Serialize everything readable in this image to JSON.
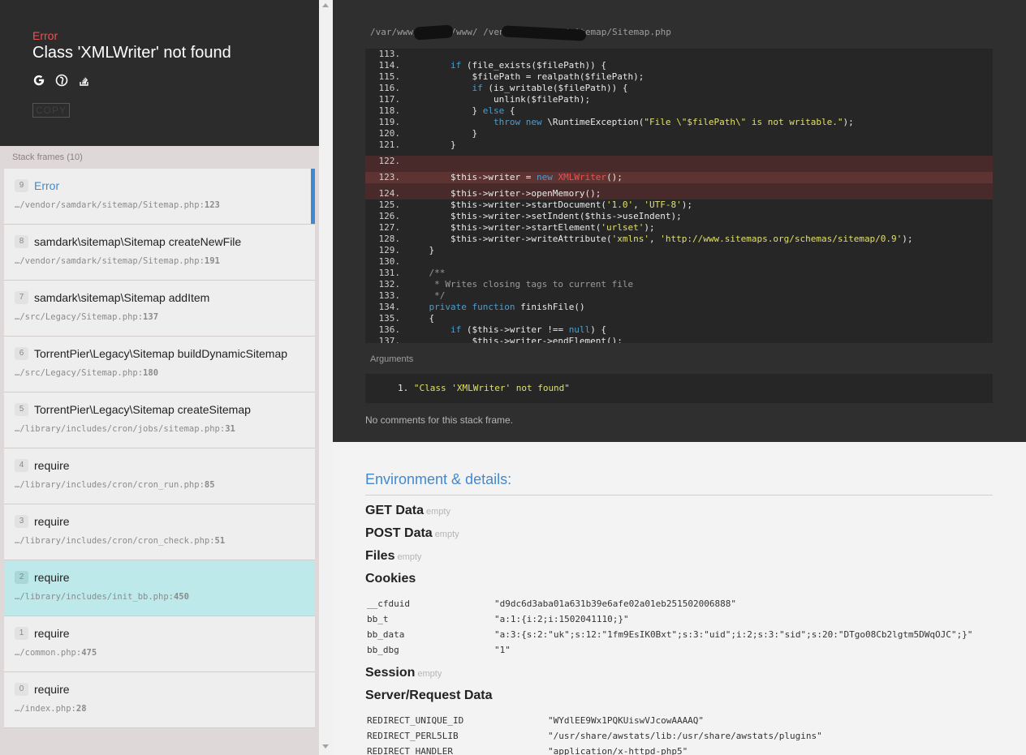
{
  "header": {
    "exception_type": "Error",
    "exception_message": "Class 'XMLWriter' not found",
    "search_icons": [
      "google-icon",
      "duckduckgo-icon",
      "stackoverflow-icon"
    ],
    "copy_label": "COPY"
  },
  "frames_title": "Stack frames (10)",
  "frames": [
    {
      "index": "9",
      "class": "Error",
      "path": "…/vendor/samdark/sitemap/Sitemap.php",
      "line": "123",
      "state": "active"
    },
    {
      "index": "8",
      "class": "samdark\\sitemap\\Sitemap createNewFile",
      "path": "…/vendor/samdark/sitemap/Sitemap.php",
      "line": "191",
      "state": ""
    },
    {
      "index": "7",
      "class": "samdark\\sitemap\\Sitemap addItem",
      "path": "…/src/Legacy/Sitemap.php",
      "line": "137",
      "state": ""
    },
    {
      "index": "6",
      "class": "TorrentPier\\Legacy\\Sitemap buildDynamicSitemap",
      "path": "…/src/Legacy/Sitemap.php",
      "line": "180",
      "state": ""
    },
    {
      "index": "5",
      "class": "TorrentPier\\Legacy\\Sitemap createSitemap",
      "path": "…/library/includes/cron/jobs/sitemap.php",
      "line": "31",
      "state": ""
    },
    {
      "index": "4",
      "class": "require",
      "path": "…/library/includes/cron/cron_run.php",
      "line": "85",
      "state": ""
    },
    {
      "index": "3",
      "class": "require",
      "path": "…/library/includes/cron/cron_check.php",
      "line": "51",
      "state": ""
    },
    {
      "index": "2",
      "class": "require",
      "path": "…/library/includes/init_bb.php",
      "line": "450",
      "state": "highlight"
    },
    {
      "index": "1",
      "class": "require",
      "path": "…/common.php",
      "line": "475",
      "state": ""
    },
    {
      "index": "0",
      "class": "require",
      "path": "…/index.php",
      "line": "28",
      "state": ""
    }
  ],
  "code": {
    "file_path": "/var/www/        /data/www/                  /vendor/samdark/sitemap/Sitemap.php",
    "lines": [
      {
        "n": "113.",
        "html": ""
      },
      {
        "n": "114.",
        "html": "        <span class='kw'>if</span> (file_exists($filePath)) {"
      },
      {
        "n": "115.",
        "html": "            $filePath = realpath($filePath);"
      },
      {
        "n": "116.",
        "html": "            <span class='kw'>if</span> (is_writable($filePath)) {"
      },
      {
        "n": "117.",
        "html": "                unlink($filePath);"
      },
      {
        "n": "118.",
        "html": "            } <span class='kw'>else</span> {"
      },
      {
        "n": "119.",
        "html": "                <span class='kw'>throw new</span> \\RuntimeException(<span class='str'>\"File \\\"$filePath\\\" is not writable.\"</span>);"
      },
      {
        "n": "120.",
        "html": "            }"
      },
      {
        "n": "121.",
        "html": "        }"
      },
      {
        "n": "",
        "html": "",
        "gap": true
      },
      {
        "n": "122.",
        "html": "",
        "hl": "err"
      },
      {
        "n": "",
        "html": "",
        "gap": true,
        "hl": "err"
      },
      {
        "n": "123.",
        "html": "        $this->writer = <span class='kw'>new</span> <span class='cls'>XMLWriter</span>();",
        "hl": "err2"
      },
      {
        "n": "",
        "html": "",
        "gap": true,
        "hl": "err"
      },
      {
        "n": "124.",
        "html": "        $this->writer->openMemory();",
        "hl": "err"
      },
      {
        "n": "125.",
        "html": "        $this->writer->startDocument(<span class='str'>'1.0'</span>, <span class='str'>'UTF-8'</span>);"
      },
      {
        "n": "126.",
        "html": "        $this->writer->setIndent($this->useIndent);"
      },
      {
        "n": "127.",
        "html": "        $this->writer->startElement(<span class='str'>'urlset'</span>);"
      },
      {
        "n": "128.",
        "html": "        $this->writer->writeAttribute(<span class='str'>'xmlns'</span>, <span class='str'>'http://www.sitemaps.org/schemas/sitemap/0.9'</span>);"
      },
      {
        "n": "129.",
        "html": "    }"
      },
      {
        "n": "130.",
        "html": ""
      },
      {
        "n": "131.",
        "html": "    <span class='cmt'>/**</span>"
      },
      {
        "n": "132.",
        "html": "<span class='cmt'>     * Writes closing tags to current file</span>"
      },
      {
        "n": "133.",
        "html": "<span class='cmt'>     */</span>"
      },
      {
        "n": "134.",
        "html": "    <span class='kw'>private function</span> finishFile()"
      },
      {
        "n": "135.",
        "html": "    {"
      },
      {
        "n": "136.",
        "html": "        <span class='kw'>if</span> ($this->writer !== <span class='kw'>null</span>) {"
      },
      {
        "n": "137.",
        "html": "            $this->writer->endElement();"
      }
    ]
  },
  "arguments_title": "Arguments",
  "arguments": [
    {
      "index": "1.",
      "value": "\"Class 'XMLWriter' not found\""
    }
  ],
  "no_comments": "No comments for this stack frame.",
  "env": {
    "title": "Environment & details:",
    "get_label": "GET Data",
    "post_label": "POST Data",
    "files_label": "Files",
    "empty_label": "empty",
    "cookies_label": "Cookies",
    "cookies": [
      {
        "k": "__cfduid",
        "v": "\"d9dc6d3aba01a631b39e6afe02a01eb251502006888\""
      },
      {
        "k": "bb_t",
        "v": "\"a:1:{i:2;i:1502041110;}\""
      },
      {
        "k": "bb_data",
        "v": "\"a:3:{s:2:\"uk\";s:12:\"1fm9EsIK0Bxt\";s:3:\"uid\";i:2;s:3:\"sid\";s:20:\"DTgo08Cb2lgtm5DWqOJC\";}\""
      },
      {
        "k": "bb_dbg",
        "v": "\"1\""
      }
    ],
    "session_label": "Session",
    "server_label": "Server/Request Data",
    "server": [
      {
        "k": "REDIRECT_UNIQUE_ID",
        "v": "\"WYdlEE9Wx1PQKUiswVJcowAAAAQ\""
      },
      {
        "k": "REDIRECT_PERL5LIB",
        "v": "\"/usr/share/awstats/lib:/usr/share/awstats/plugins\""
      },
      {
        "k": "REDIRECT_HANDLER",
        "v": "\"application/x-httpd-php5\""
      }
    ]
  },
  "colors": {
    "accent": "#4288ce",
    "error": "#e95353",
    "highlight": "#bde9ea",
    "dark_bg": "#2f2f2f"
  }
}
